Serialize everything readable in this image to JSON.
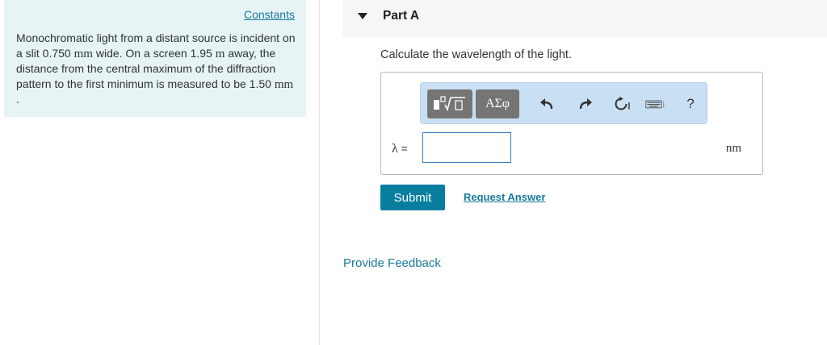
{
  "left_panel": {
    "constants_link": "Constants",
    "problem": {
      "t1": "Monochromatic light from a distant source is incident on a slit 0.750 ",
      "u1": "mm",
      "t2": " wide. On a screen 1.95 ",
      "u2": "m",
      "t3": " away, the distance from the central maximum of the diffraction pattern to the first minimum is measured to be 1.50 ",
      "u3": "mm",
      "t4": " ."
    }
  },
  "part": {
    "title": "Part A",
    "question": "Calculate the wavelength of the light."
  },
  "toolbar": {
    "greek_label": "ΑΣφ",
    "help_label": "?",
    "icons": [
      "templates-icon",
      "greek-letters-icon",
      "undo-icon",
      "redo-icon",
      "reset-icon",
      "keyboard-icon",
      "help-icon"
    ]
  },
  "answer": {
    "variable": "λ",
    "equals": "=",
    "value": "",
    "unit": "nm"
  },
  "actions": {
    "submit_label": "Submit",
    "request_answer_label": "Request Answer",
    "feedback_label": "Provide Feedback"
  },
  "colors": {
    "panel_bg": "#e6f4f6",
    "accent": "#087e9f",
    "link": "#1a7a9c",
    "toolbar_bg": "#c9dff3"
  }
}
